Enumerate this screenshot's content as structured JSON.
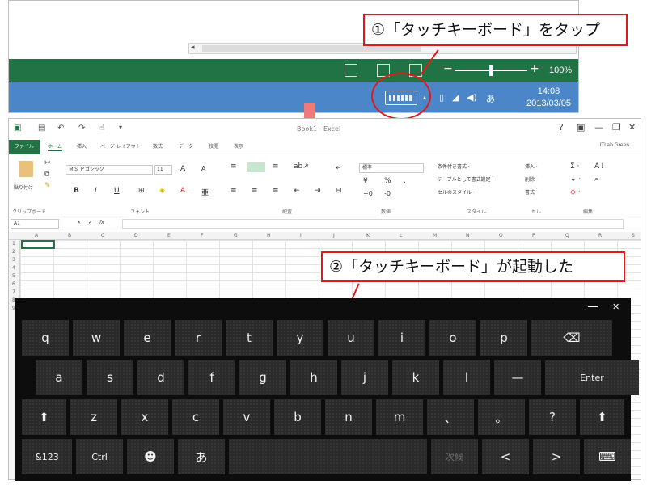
{
  "top_panel": {
    "zoom_minus": "−",
    "zoom_plus": "+",
    "zoom_percent": "100%",
    "clock_time": "14:08",
    "clock_date": "2013/03/05",
    "scroll_arrow": "◂"
  },
  "callouts": {
    "step1": "①「タッチキーボード」をタップ",
    "step2": "②「タッチキーボード」が起動した"
  },
  "excel": {
    "title": "Book1 - Excel",
    "user": "ITLab Green",
    "tabs": [
      "ファイル",
      "ホーム",
      "挿入",
      "ページ レイアウト",
      "数式",
      "データ",
      "校閲",
      "表示"
    ],
    "font_name": "ＭＳ Ｐゴシック",
    "font_size": "11",
    "number_format": "標準",
    "name_box": "A1",
    "paste_label": "貼り付け",
    "styles": [
      "条件付き書式 ·",
      "テーブルとして書式設定 ·",
      "セルのスタイル ·"
    ],
    "cells": [
      "挿入 ·",
      "削除 ·",
      "書式 ·"
    ],
    "groups": [
      "クリップボード",
      "フォント",
      "配置",
      "数値",
      "スタイル",
      "セル",
      "編集"
    ],
    "columns": [
      "A",
      "B",
      "C",
      "D",
      "E",
      "F",
      "G",
      "H",
      "I",
      "J",
      "K",
      "L",
      "M",
      "N",
      "O",
      "P",
      "Q",
      "R",
      "S"
    ],
    "rows": [
      "1",
      "2",
      "3",
      "4",
      "5",
      "6",
      "7",
      "8",
      "9"
    ]
  },
  "keyboard": {
    "row1": [
      "q",
      "w",
      "e",
      "r",
      "t",
      "y",
      "u",
      "i",
      "o",
      "p",
      "⌫"
    ],
    "row2": [
      "a",
      "s",
      "d",
      "f",
      "g",
      "h",
      "j",
      "k",
      "l",
      "—",
      "Enter"
    ],
    "row3": [
      "⬆",
      "z",
      "x",
      "c",
      "v",
      "b",
      "n",
      "m",
      "、",
      "。",
      "?",
      "⬆"
    ],
    "row4": [
      "&123",
      "Ctrl",
      "☻",
      "あ",
      "",
      "次候",
      "<",
      ">",
      "⌨"
    ],
    "minimize_label": "▁",
    "close_label": "✕"
  },
  "colors": {
    "excel_green": "#217346",
    "taskbar_blue": "#4a86c8",
    "callout_red": "#e11919",
    "keyboard_bg": "#0d0d0d",
    "key_bg": "#2b2b2b"
  }
}
